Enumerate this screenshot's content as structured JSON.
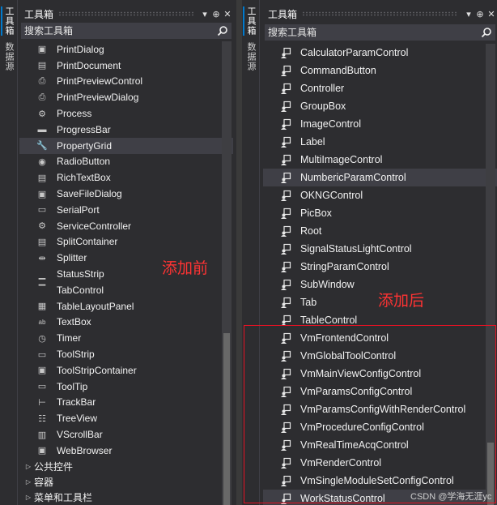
{
  "left_panel": {
    "side_tabs": [
      "工具箱",
      "数据源"
    ],
    "title": "工具箱",
    "title_buttons": [
      "▾",
      "⊕",
      "✕"
    ],
    "search_placeholder": "搜索工具箱",
    "items": [
      {
        "label": "PrintDialog",
        "icon": "print-dialog-icon",
        "glyph": "▣"
      },
      {
        "label": "PrintDocument",
        "icon": "print-document-icon",
        "glyph": "▤"
      },
      {
        "label": "PrintPreviewControl",
        "icon": "print-preview-control-icon",
        "glyph": "⎙"
      },
      {
        "label": "PrintPreviewDialog",
        "icon": "print-preview-dialog-icon",
        "glyph": "⎙"
      },
      {
        "label": "Process",
        "icon": "process-icon",
        "glyph": "⚙"
      },
      {
        "label": "ProgressBar",
        "icon": "progress-bar-icon",
        "glyph": "▬"
      },
      {
        "label": "PropertyGrid",
        "icon": "property-grid-icon",
        "glyph": "🔧"
      },
      {
        "label": "RadioButton",
        "icon": "radio-button-icon",
        "glyph": "◉"
      },
      {
        "label": "RichTextBox",
        "icon": "rich-text-box-icon",
        "glyph": "▤"
      },
      {
        "label": "SaveFileDialog",
        "icon": "save-file-dialog-icon",
        "glyph": "▣"
      },
      {
        "label": "SerialPort",
        "icon": "serial-port-icon",
        "glyph": "▭"
      },
      {
        "label": "ServiceController",
        "icon": "service-controller-icon",
        "glyph": "⚙"
      },
      {
        "label": "SplitContainer",
        "icon": "split-container-icon",
        "glyph": "▤"
      },
      {
        "label": "Splitter",
        "icon": "splitter-icon",
        "glyph": "⇹"
      },
      {
        "label": "StatusStrip",
        "icon": "status-strip-icon",
        "glyph": "▁"
      },
      {
        "label": "TabControl",
        "icon": "tab-control-icon",
        "glyph": "▔"
      },
      {
        "label": "TableLayoutPanel",
        "icon": "table-layout-panel-icon",
        "glyph": "▦"
      },
      {
        "label": "TextBox",
        "icon": "text-box-icon",
        "glyph": "ab"
      },
      {
        "label": "Timer",
        "icon": "timer-icon",
        "glyph": "◷"
      },
      {
        "label": "ToolStrip",
        "icon": "tool-strip-icon",
        "glyph": "▭"
      },
      {
        "label": "ToolStripContainer",
        "icon": "tool-strip-container-icon",
        "glyph": "▣"
      },
      {
        "label": "ToolTip",
        "icon": "tool-tip-icon",
        "glyph": "▭"
      },
      {
        "label": "TrackBar",
        "icon": "track-bar-icon",
        "glyph": "⊢"
      },
      {
        "label": "TreeView",
        "icon": "tree-view-icon",
        "glyph": "☷"
      },
      {
        "label": "VScrollBar",
        "icon": "vscroll-bar-icon",
        "glyph": "▥"
      },
      {
        "label": "WebBrowser",
        "icon": "web-browser-icon",
        "glyph": "▣"
      }
    ],
    "selected_item": "PropertyGrid",
    "groups": [
      "公共控件",
      "容器",
      "菜单和工具栏"
    ],
    "annotation": "添加前"
  },
  "right_panel": {
    "side_tabs": [
      "工具箱",
      "数据源"
    ],
    "title": "工具箱",
    "title_buttons": [
      "▾",
      "⊕",
      "✕"
    ],
    "search_placeholder": "搜索工具箱",
    "items": [
      "CalculatorParamControl",
      "CommandButton",
      "Controller",
      "GroupBox",
      "ImageControl",
      "Label",
      "MultiImageControl",
      "NumbericParamControl",
      "OKNGControl",
      "PicBox",
      "Root",
      "SignalStatusLightControl",
      "StringParamControl",
      "SubWindow",
      "Tab",
      "TableControl",
      "VmFrontendControl",
      "VmGlobalToolControl",
      "VmMainViewConfigControl",
      "VmParamsConfigControl",
      "VmParamsConfigWithRenderControl",
      "VmProcedureConfigControl",
      "VmRealTimeAcqControl",
      "VmRenderControl",
      "VmSingleModuleSetConfigControl",
      "WorkStatusControl"
    ],
    "hovered_item": "NumbericParamControl",
    "last_selected_item": "WorkStatusControl",
    "item_icon": "user-control-icon",
    "annotation": "添加后"
  },
  "watermark": "CSDN @学海无涯yc",
  "colors": {
    "background": "#2d2d30",
    "search_bg": "#3f3f46",
    "annotation_red": "#ff3333",
    "box_red": "#e81123",
    "accent": "#007acc"
  }
}
